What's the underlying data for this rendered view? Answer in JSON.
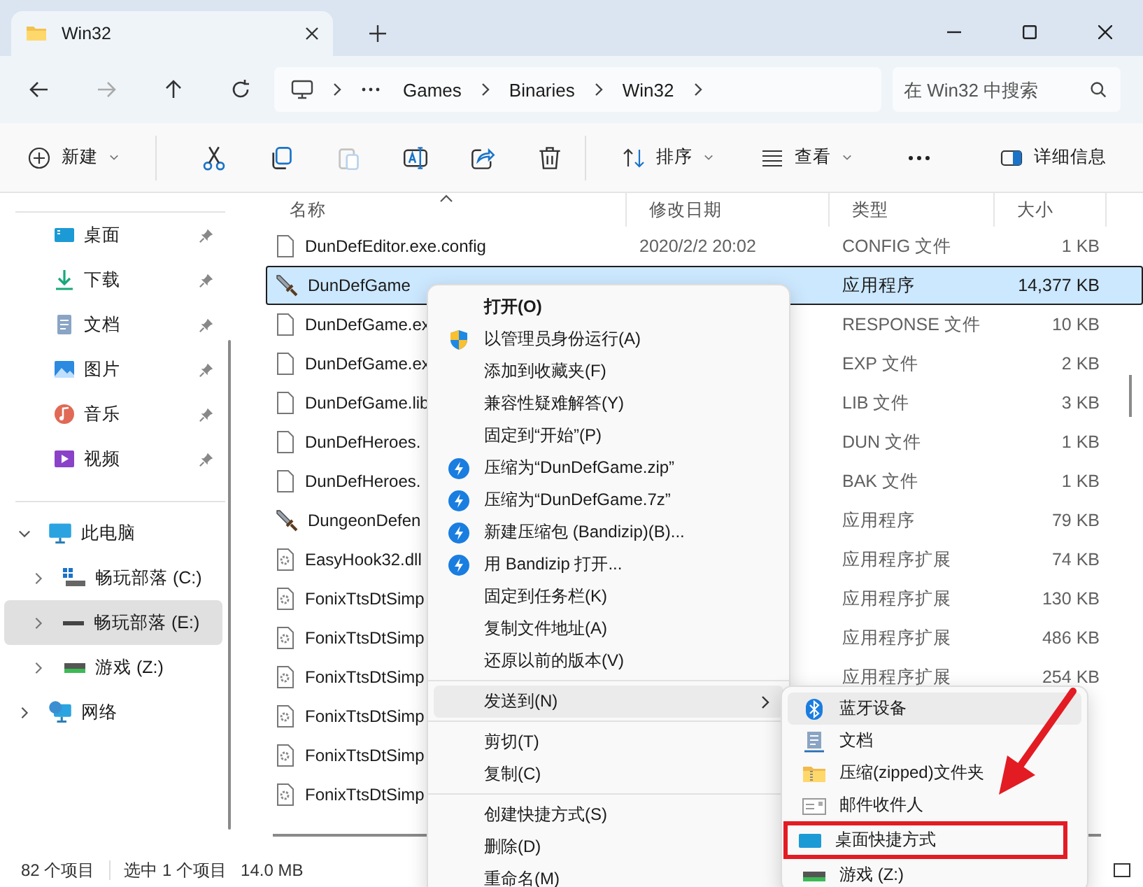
{
  "tab": {
    "title": "Win32"
  },
  "address_bar": {
    "forward_disabled": true,
    "crumbs": [
      "Games",
      "Binaries",
      "Win32"
    ],
    "search": {
      "placeholder": "在 Win32 中搜索"
    }
  },
  "toolbar": {
    "new": "新建",
    "sort": "排序",
    "view": "查看",
    "details": "详细信息",
    "paste_disabled": true
  },
  "sidebar": {
    "quick_access": [
      {
        "label": "桌面",
        "pinned": true
      },
      {
        "label": "下载",
        "pinned": true
      },
      {
        "label": "文档",
        "pinned": true
      },
      {
        "label": "图片",
        "pinned": true
      },
      {
        "label": "音乐",
        "pinned": true
      },
      {
        "label": "视频",
        "pinned": true
      }
    ],
    "tree": [
      {
        "label": "此电脑",
        "expanded": true,
        "selected": false,
        "children": [
          {
            "label": "畅玩部落 (C:)",
            "expanded": false,
            "selected": false
          },
          {
            "label": "畅玩部落 (E:)",
            "expanded": false,
            "selected": true
          },
          {
            "label": "游戏 (Z:)",
            "expanded": false,
            "selected": false
          }
        ]
      },
      {
        "label": "网络",
        "expanded": false,
        "selected": false
      }
    ]
  },
  "table": {
    "columns": [
      {
        "label": "名称",
        "sorted": true
      },
      {
        "label": "修改日期",
        "sorted": false
      },
      {
        "label": "类型",
        "sorted": false
      },
      {
        "label": "大小",
        "sorted": false
      }
    ],
    "rows": [
      {
        "name": "DunDefEditor.exe.config",
        "date": "2020/2/2 20:02",
        "type": "CONFIG 文件",
        "size": "1 KB",
        "selected": false
      },
      {
        "name": "DunDefGame",
        "type": "应用程序",
        "size": "14,377 KB",
        "selected": true
      },
      {
        "name": "DunDefGame.ex",
        "type": "RESPONSE 文件",
        "size": "10 KB",
        "selected": false
      },
      {
        "name": "DunDefGame.ex",
        "type": "EXP 文件",
        "size": "2 KB",
        "selected": false
      },
      {
        "name": "DunDefGame.lib",
        "type": "LIB 文件",
        "size": "3 KB",
        "selected": false
      },
      {
        "name": "DunDefHeroes.",
        "type": "DUN 文件",
        "size": "1 KB",
        "selected": false
      },
      {
        "name": "DunDefHeroes.",
        "type": "BAK 文件",
        "size": "1 KB",
        "selected": false
      },
      {
        "name": "DungeonDefen",
        "type": "应用程序",
        "size": "79 KB",
        "selected": false
      },
      {
        "name": "EasyHook32.dll",
        "type": "应用程序扩展",
        "size": "74 KB",
        "selected": false
      },
      {
        "name": "FonixTtsDtSimp",
        "type": "应用程序扩展",
        "size": "130 KB",
        "selected": false
      },
      {
        "name": "FonixTtsDtSimp",
        "type": "应用程序扩展",
        "size": "486 KB",
        "selected": false
      },
      {
        "name": "FonixTtsDtSimp",
        "type": "应用程序扩展",
        "size": "254 KB",
        "selected": false
      },
      {
        "name": "FonixTtsDtSimp",
        "selected": false
      },
      {
        "name": "FonixTtsDtSimp",
        "selected": false
      },
      {
        "name": "FonixTtsDtSimp",
        "selected": false
      }
    ]
  },
  "status_bar": {
    "count": "82 个项目",
    "selection": "选中 1 个项目",
    "size": "14.0 MB"
  },
  "context_menu": {
    "groups": [
      [
        {
          "label": "打开(O)",
          "default": true
        },
        {
          "label": "以管理员身份运行(A)"
        },
        {
          "label": "添加到收藏夹(F)"
        },
        {
          "label": "兼容性疑难解答(Y)"
        },
        {
          "label": "固定到“开始”(P)"
        },
        {
          "label": "压缩为“DunDefGame.zip”"
        },
        {
          "label": "压缩为“DunDefGame.7z”"
        },
        {
          "label": "新建压缩包 (Bandizip)(B)..."
        },
        {
          "label": "用 Bandizip 打开..."
        },
        {
          "label": "固定到任务栏(K)"
        },
        {
          "label": "复制文件地址(A)"
        },
        {
          "label": "还原以前的版本(V)"
        }
      ],
      [
        {
          "label": "发送到(N)",
          "submenu": true,
          "highlighted": true
        }
      ],
      [
        {
          "label": "剪切(T)"
        },
        {
          "label": "复制(C)"
        }
      ],
      [
        {
          "label": "创建快捷方式(S)"
        },
        {
          "label": "删除(D)"
        },
        {
          "label": "重命名(M)"
        }
      ]
    ]
  },
  "send_to_menu": {
    "items": [
      {
        "label": "蓝牙设备",
        "highlighted": true,
        "marked": false
      },
      {
        "label": "文档",
        "highlighted": false,
        "marked": false
      },
      {
        "label": "压缩(zipped)文件夹",
        "highlighted": false,
        "marked": false
      },
      {
        "label": "邮件收件人",
        "highlighted": false,
        "marked": false
      },
      {
        "label": "桌面快捷方式",
        "highlighted": false,
        "marked": true
      },
      {
        "label": "游戏 (Z:)",
        "highlighted": false,
        "marked": false
      }
    ]
  }
}
